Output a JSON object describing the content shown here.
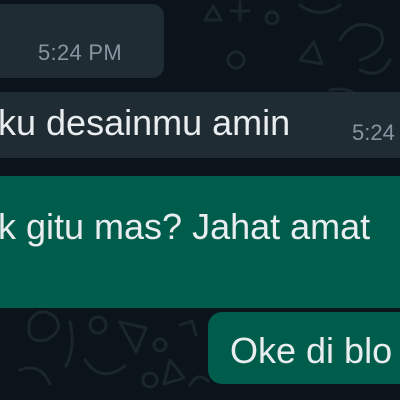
{
  "conversation": {
    "messages": [
      {
        "direction": "incoming",
        "text": "",
        "time": "5:24 PM"
      },
      {
        "direction": "incoming",
        "text": "ku desainmu amin",
        "time": "5:24"
      },
      {
        "direction": "outgoing",
        "text": "k gitu mas? Jahat amat"
      },
      {
        "direction": "outgoing",
        "text": "Oke di blo"
      }
    ]
  },
  "colors": {
    "background": "#0b141a",
    "incoming_bubble": "#1f2c33",
    "outgoing_bubble": "#005c4b",
    "text": "#e9edef",
    "timestamp": "#8696a0"
  },
  "icons": [
    "wallpaper-doodle-pattern"
  ]
}
